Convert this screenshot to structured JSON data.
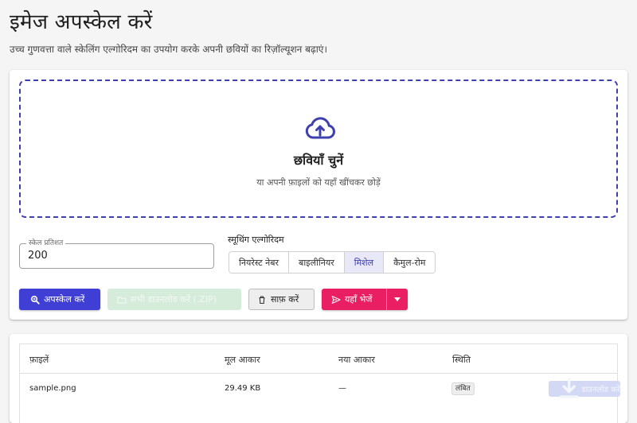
{
  "header": {
    "title": "इमेज अपस्केल करें",
    "subtitle": "उच्च गुणवत्ता वाले स्केलिंग एल्गोरिदम का उपयोग करके अपनी छवियों का रिज़ॉल्यूशन बढ़ाएं।"
  },
  "dropzone": {
    "title": "छवियाँ चुनें",
    "hint": "या अपनी फ़ाइलों को यहाँ खींचकर छोड़ें",
    "icon": "cloud-upload-icon",
    "accent": "#3f3fb0"
  },
  "scale": {
    "label": "स्केल प्रतिशत",
    "value": "200"
  },
  "algorithm": {
    "label": "स्मूथिंग एल्गोरिदम",
    "options": [
      "नियरेस्ट नेबर",
      "बाइलीनियर",
      "मिशेल",
      "कैमुल-रोम"
    ],
    "selected": "मिशेल"
  },
  "actions": {
    "upscale": "अपस्केल करें",
    "download_all": "सभी डाउनलोड करें (.ZIP)",
    "clear": "साफ़ करें",
    "send_here": "यहाँ भेजें"
  },
  "colors": {
    "primary": "#3f3fd6",
    "success_disabled": "#d6ecdb",
    "send": "#e91e63"
  },
  "files_table": {
    "columns": [
      "फ़ाइलें",
      "मूल आकार",
      "नया आकार",
      "स्थिति"
    ],
    "rows": [
      {
        "name": "sample.png",
        "original_size": "29.49 KB",
        "new_size": "—",
        "status": "लंबित",
        "download": "डाउनलोड करें"
      }
    ]
  }
}
